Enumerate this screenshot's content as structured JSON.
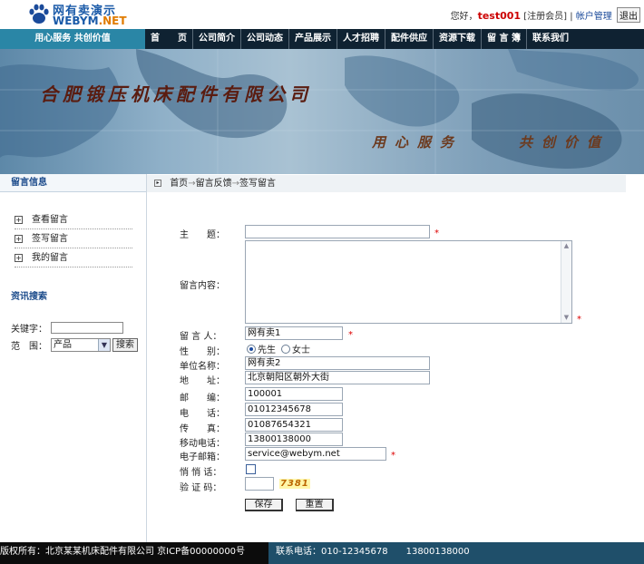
{
  "logo": {
    "name_cn": "网有卖演示",
    "name_en_1": "WEBYM",
    "name_en_2": ".NET"
  },
  "userbar": {
    "greeting": "您好，",
    "username": "test001",
    "member_type": "[注册会员]",
    "separator": "|",
    "account_link": "帐户管理",
    "logout": "退出"
  },
  "slogan": "用心服务  共创价值",
  "nav": [
    "首　　页",
    "公司简介",
    "公司动态",
    "产品展示",
    "人才招聘",
    "配件供应",
    "资源下载",
    "留 言 簿",
    "联系我们"
  ],
  "banner": {
    "company": "合肥锻压机床配件有限公司",
    "slogan1": "用心服务",
    "slogan2": "共创价值"
  },
  "sidebar": {
    "message_title": "留言信息",
    "links": [
      "查看留言",
      "签写留言",
      "我的留言"
    ],
    "search_title": "资讯搜索",
    "keyword_label": "关键字：",
    "scope_label": "范　围：",
    "scope_value": "产品",
    "search_button": "搜索"
  },
  "breadcrumb": {
    "home": "首页",
    "section": "留言反馈",
    "current": "签写留言",
    "arrow": "→"
  },
  "form": {
    "subject_label": "主　　题：",
    "content_label": "留言内容：",
    "author_label": "留 言 人：",
    "author_value": "网有卖1",
    "gender_label": "性　　别：",
    "gender_male": "先生",
    "gender_female": "女士",
    "company_label": "单位名称：",
    "company_value": "网有卖2",
    "address_label": "地　　址：",
    "address_value": "北京朝阳区朝外大街",
    "postcode_label": "邮　　编：",
    "postcode_value": "100001",
    "phone_label": "电　　话：",
    "phone_value": "01012345678",
    "fax_label": "传　　真：",
    "fax_value": "01087654321",
    "mobile_label": "移动电话：",
    "mobile_value": "13800138000",
    "email_label": "电子邮箱：",
    "email_value": "service@webym.net",
    "private_label": "悄 悄 话：",
    "captcha_label": "验 证 码：",
    "captcha_image": "7381",
    "required_mark": "*",
    "save_button": "保存",
    "reset_button": "重置"
  },
  "footer": {
    "copyright": "版权所有：北京某某机床配件有限公司 京ICP备00000000号",
    "phone_label": "联系电话：010-12345678",
    "mobile": "13800138000"
  },
  "colors": {
    "nav_bg": "#0f2232",
    "slogan_bg": "#2a86a6",
    "footer_right_bg": "#1f4f6a",
    "required": "#d00"
  }
}
